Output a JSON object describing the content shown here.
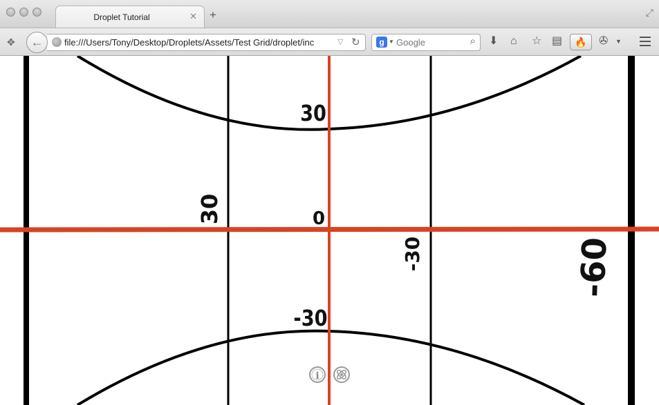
{
  "window": {
    "tab_title": "Droplet Tutorial",
    "tab_close": "✕",
    "new_tab": "+"
  },
  "navbar": {
    "url": "file:///Users/Tony/Desktop/Droplets/Assets/Test Grid/droplet/inc",
    "search_placeholder": "Google",
    "search_engine_icon": "google-icon"
  },
  "grid": {
    "labels": {
      "top": "30",
      "bottom": "-30",
      "origin": "0",
      "left": "30",
      "right": "-30",
      "far_right": "-60"
    },
    "colors": {
      "axis": "#d84322",
      "line": "#000000",
      "background": "#ffffff"
    }
  },
  "controls": {
    "info_icon": "info-icon",
    "settings_icon": "atom-icon"
  }
}
